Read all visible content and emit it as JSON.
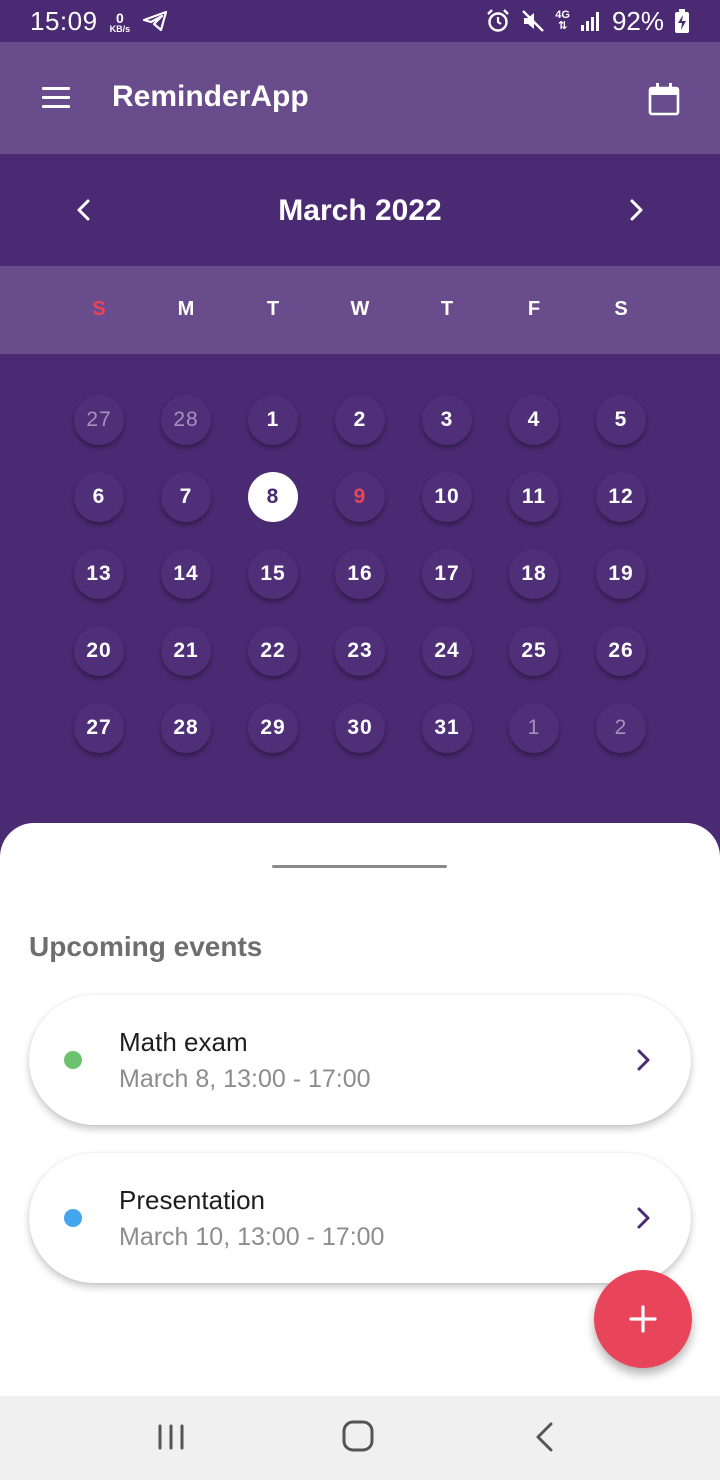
{
  "status_bar": {
    "time": "15:09",
    "data_rate_value": "0",
    "data_rate_unit": "KB/s",
    "network_type": "4G",
    "battery": "92%",
    "icons": [
      "telegram-icon",
      "alarm-icon",
      "mute-icon",
      "signal-icon",
      "battery-charging-icon"
    ]
  },
  "app_bar": {
    "title": "ReminderApp",
    "menu_icon": "hamburger-menu-icon",
    "action_icon": "calendar-icon"
  },
  "calendar": {
    "month_title": "March 2022",
    "prev_icon": "chevron-left-icon",
    "next_icon": "chevron-right-icon",
    "weekdays": [
      "S",
      "M",
      "T",
      "W",
      "T",
      "F",
      "S"
    ],
    "weeks": [
      [
        "27",
        "28",
        "1",
        "2",
        "3",
        "4",
        "5"
      ],
      [
        "6",
        "7",
        "8",
        "9",
        "10",
        "11",
        "12"
      ],
      [
        "13",
        "14",
        "15",
        "16",
        "17",
        "18",
        "19"
      ],
      [
        "20",
        "21",
        "22",
        "23",
        "24",
        "25",
        "26"
      ],
      [
        "27",
        "28",
        "29",
        "30",
        "31",
        "1",
        "2"
      ]
    ],
    "selected_day": "8",
    "holiday_day": "9"
  },
  "events": {
    "section_title": "Upcoming events",
    "items": [
      {
        "name": "Math exam",
        "time": "March 8, 13:00 - 17:00",
        "color": "#6cc36f"
      },
      {
        "name": "Presentation",
        "time": "March 10, 13:00 - 17:00",
        "color": "#45a6f0"
      }
    ]
  },
  "fab": {
    "icon": "plus-icon",
    "color": "#e8445a"
  },
  "nav_bar": {
    "icons": [
      "recent-apps-icon",
      "home-icon",
      "back-icon"
    ]
  },
  "colors": {
    "primary": "#4a2a72",
    "primary_light": "#694c8b",
    "accent": "#e8445a",
    "sunday_header": "#e8445a"
  }
}
